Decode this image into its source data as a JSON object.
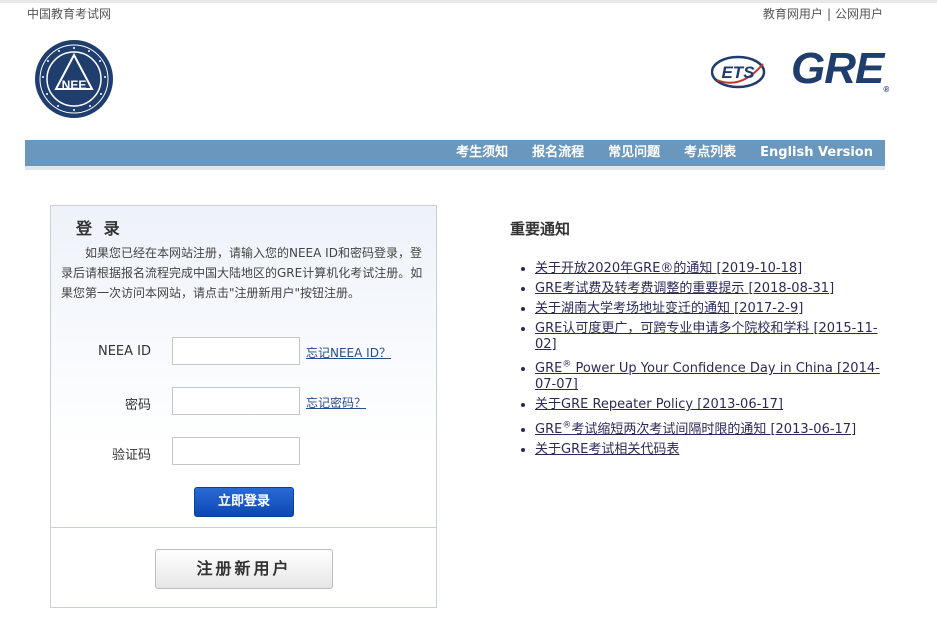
{
  "header": {
    "site_name": "中国教育考试网",
    "user_links": [
      "教育网用户",
      "公网用户"
    ],
    "user_links_sep": "|",
    "neea_logo_text": "NEE",
    "ets_logo_text": "ETS",
    "gre_logo_text": "GRE"
  },
  "nav": {
    "items": [
      "考生须知",
      "报名流程",
      "常见问题",
      "考点列表",
      "English Version"
    ]
  },
  "login": {
    "title": "登 录",
    "description": "如果您已经在本网站注册，请输入您的NEEA ID和密码登录，登录后请根据报名流程完成中国大陆地区的GRE计算机化考试注册。如果您第一次访问本网站，请点击\"注册新用户\"按钮注册。",
    "neea_id_label": "NEEA ID",
    "neea_id_value": "",
    "forgot_id": "忘记NEEA ID？",
    "password_label": "密码",
    "password_value": "",
    "forgot_password": "忘记密码？",
    "captcha_label": "验证码",
    "captcha_value": "",
    "login_button": "立即登录",
    "register_button": "注册新用户"
  },
  "notices": {
    "title": "重要通知",
    "items": [
      {
        "pre": "关于开放2020年GRE®的通知 [2019-10-18]"
      },
      {
        "pre": "GRE考试费及转考费调整的重要提示 [2018-08-31]"
      },
      {
        "pre": "关于湖南大学考场地址变迁的通知 [2017-2-9]"
      },
      {
        "pre": "GRE认可度更广，可跨专业申请多个院校和学科 [2015-11-02]"
      },
      {
        "pre": "GRE",
        "sup": "®",
        "post": " Power Up Your Confidence Day in China [2014-07-07]"
      },
      {
        "pre": "关于GRE Repeater Policy [2013-06-17]"
      },
      {
        "pre": "GRE",
        "sup": "®",
        "post": "考试缩短两次考试间隔时限的通知 [2013-06-17]"
      },
      {
        "pre": "关于GRE考试相关代码表"
      }
    ]
  },
  "colors": {
    "nav_bg": "#6a97bd",
    "brand_dark": "#1f3e6e",
    "login_button": "#1a5bc9",
    "link": "#2a2a55"
  }
}
